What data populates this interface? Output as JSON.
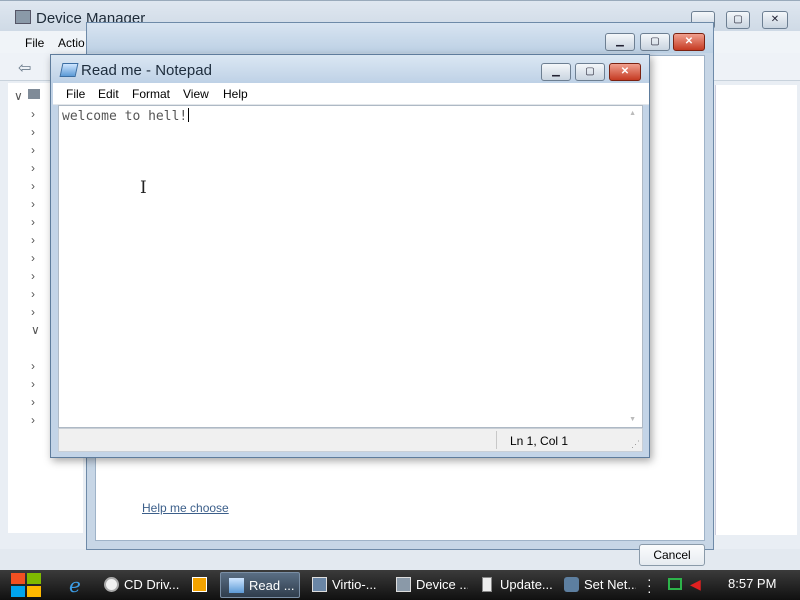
{
  "device_manager": {
    "title": "Device Manager",
    "menu": {
      "file": "File",
      "action": "Actio"
    }
  },
  "dialog": {
    "help_link": "Help me choose",
    "cancel_label": "Cancel"
  },
  "notepad": {
    "title": "Read me - Notepad",
    "menu": [
      "File",
      "Edit",
      "Format",
      "View",
      "Help"
    ],
    "content": "welcome to hell!",
    "status": "Ln 1, Col 1"
  },
  "taskbar": {
    "items": [
      {
        "label": "CD Driv...",
        "icon": "folder-icon"
      },
      {
        "label": "",
        "icon": "media-player-icon"
      },
      {
        "label": "Read ...",
        "icon": "notepad-icon",
        "active": true
      },
      {
        "label": "Virtio-...",
        "icon": "network-icon"
      },
      {
        "label": "Device ...",
        "icon": "device-manager-icon"
      },
      {
        "label": "Update...",
        "icon": "update-icon"
      },
      {
        "label": "Set Net...",
        "icon": "network-settings-icon"
      }
    ],
    "clock": "8:57 PM"
  },
  "colors": {
    "taskbar_bg": "#1f1f1f",
    "close_button": "#c53a22",
    "link": "#3c5f8a"
  }
}
